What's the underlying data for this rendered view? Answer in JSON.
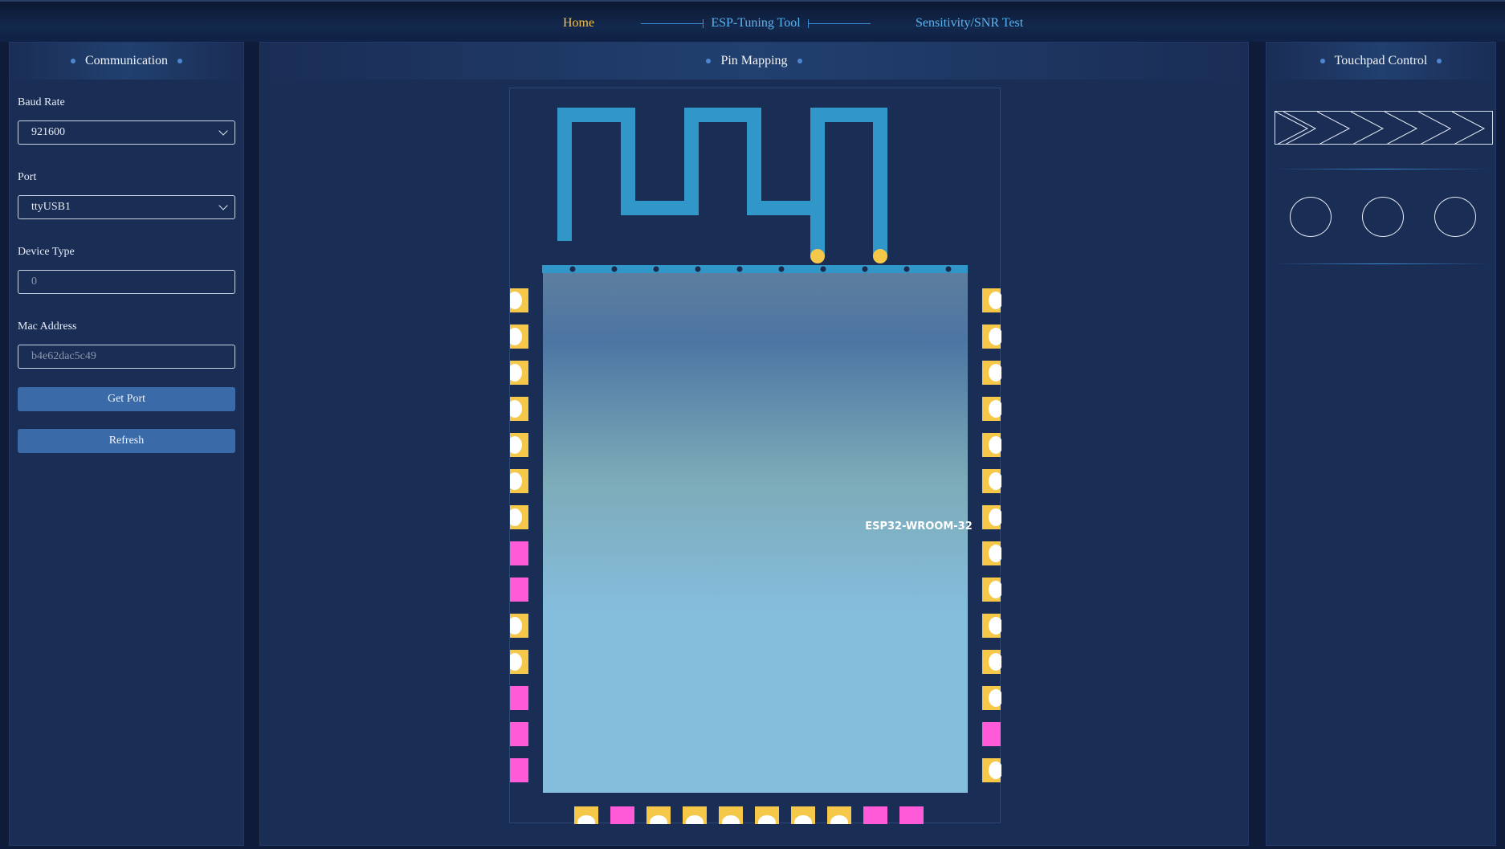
{
  "nav": {
    "home": "Home",
    "title": "ESP-Tuning Tool",
    "sensitivity": "Sensitivity/SNR Test"
  },
  "communication": {
    "title": "Communication",
    "baud_rate": {
      "label": "Baud Rate",
      "value": "921600"
    },
    "port": {
      "label": "Port",
      "value": "ttyUSB1"
    },
    "device_type": {
      "label": "Device Type",
      "placeholder": "0"
    },
    "mac_address": {
      "label": "Mac Address",
      "placeholder": "b4e62dac5c49"
    },
    "get_port_button": "Get Port",
    "refresh_button": "Refresh"
  },
  "pin_mapping": {
    "title": "Pin Mapping",
    "chip_name": "ESP32-WROOM-32",
    "left_pins": [
      "touch",
      "touch",
      "touch",
      "touch",
      "touch",
      "touch",
      "touch",
      "plain",
      "plain",
      "touch",
      "touch",
      "plain",
      "plain",
      "plain"
    ],
    "right_pins": [
      "touch",
      "touch",
      "touch",
      "touch",
      "touch",
      "touch",
      "touch",
      "touch",
      "touch",
      "touch",
      "touch",
      "touch",
      "plain",
      "touch"
    ],
    "bottom_pins": [
      "touch",
      "plain",
      "touch",
      "touch",
      "touch",
      "touch",
      "touch",
      "touch",
      "plain",
      "plain"
    ],
    "colors": {
      "touch_pin": "#f5c84a",
      "plain_pin": "#ff5ad8",
      "antenna": "#3196c8",
      "chip_top": "#5d7e9e",
      "chip_bottom": "#85bddd"
    }
  },
  "touchpad": {
    "title": "Touchpad Control",
    "buttons": [
      "button-1",
      "button-2",
      "button-3"
    ]
  }
}
